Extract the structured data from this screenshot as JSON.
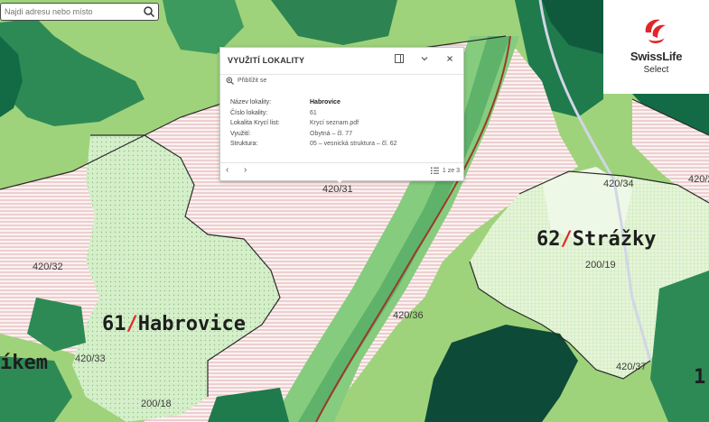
{
  "search": {
    "placeholder": "Najdi adresu nebo místo"
  },
  "logo": {
    "brand": "SwissLife",
    "sub": "Select"
  },
  "popup": {
    "title": "VYUŽITÍ LOKALITY",
    "zoom_label": "Přiblížit se",
    "fields": [
      {
        "key": "Název lokality:",
        "value": "Habrovice"
      },
      {
        "key": "Číslo lokality:",
        "value": "61"
      },
      {
        "key": "Lokalita Krycí list:",
        "value": "Krycí seznam.pdf"
      },
      {
        "key": "Využití:",
        "value": "Obytná – čl. 77"
      },
      {
        "key": "Struktura:",
        "value": "05 – vesnická struktura – čl. 62"
      }
    ],
    "pager": "1 ze 3"
  },
  "map": {
    "parcels": [
      "420/31",
      "420/34",
      "420/32",
      "420/36",
      "200/19",
      "420/33",
      "200/18",
      "420/37",
      "420/2"
    ],
    "localities": [
      {
        "num": "61",
        "name": "Habrovice"
      },
      {
        "num": "62",
        "name": "Strážky"
      }
    ],
    "partial_left": "íkem",
    "partial_right": "1",
    "colors": {
      "meadow": "#9fd37b",
      "forest": "#1c7a4e",
      "dark_forest": "#0f5a3c",
      "settlement": "#d8f0c8",
      "plan_hatch": "#f2c9c9",
      "road": "#9b3a2a",
      "water": "#0e4a38",
      "accent": "#e0262b"
    }
  }
}
